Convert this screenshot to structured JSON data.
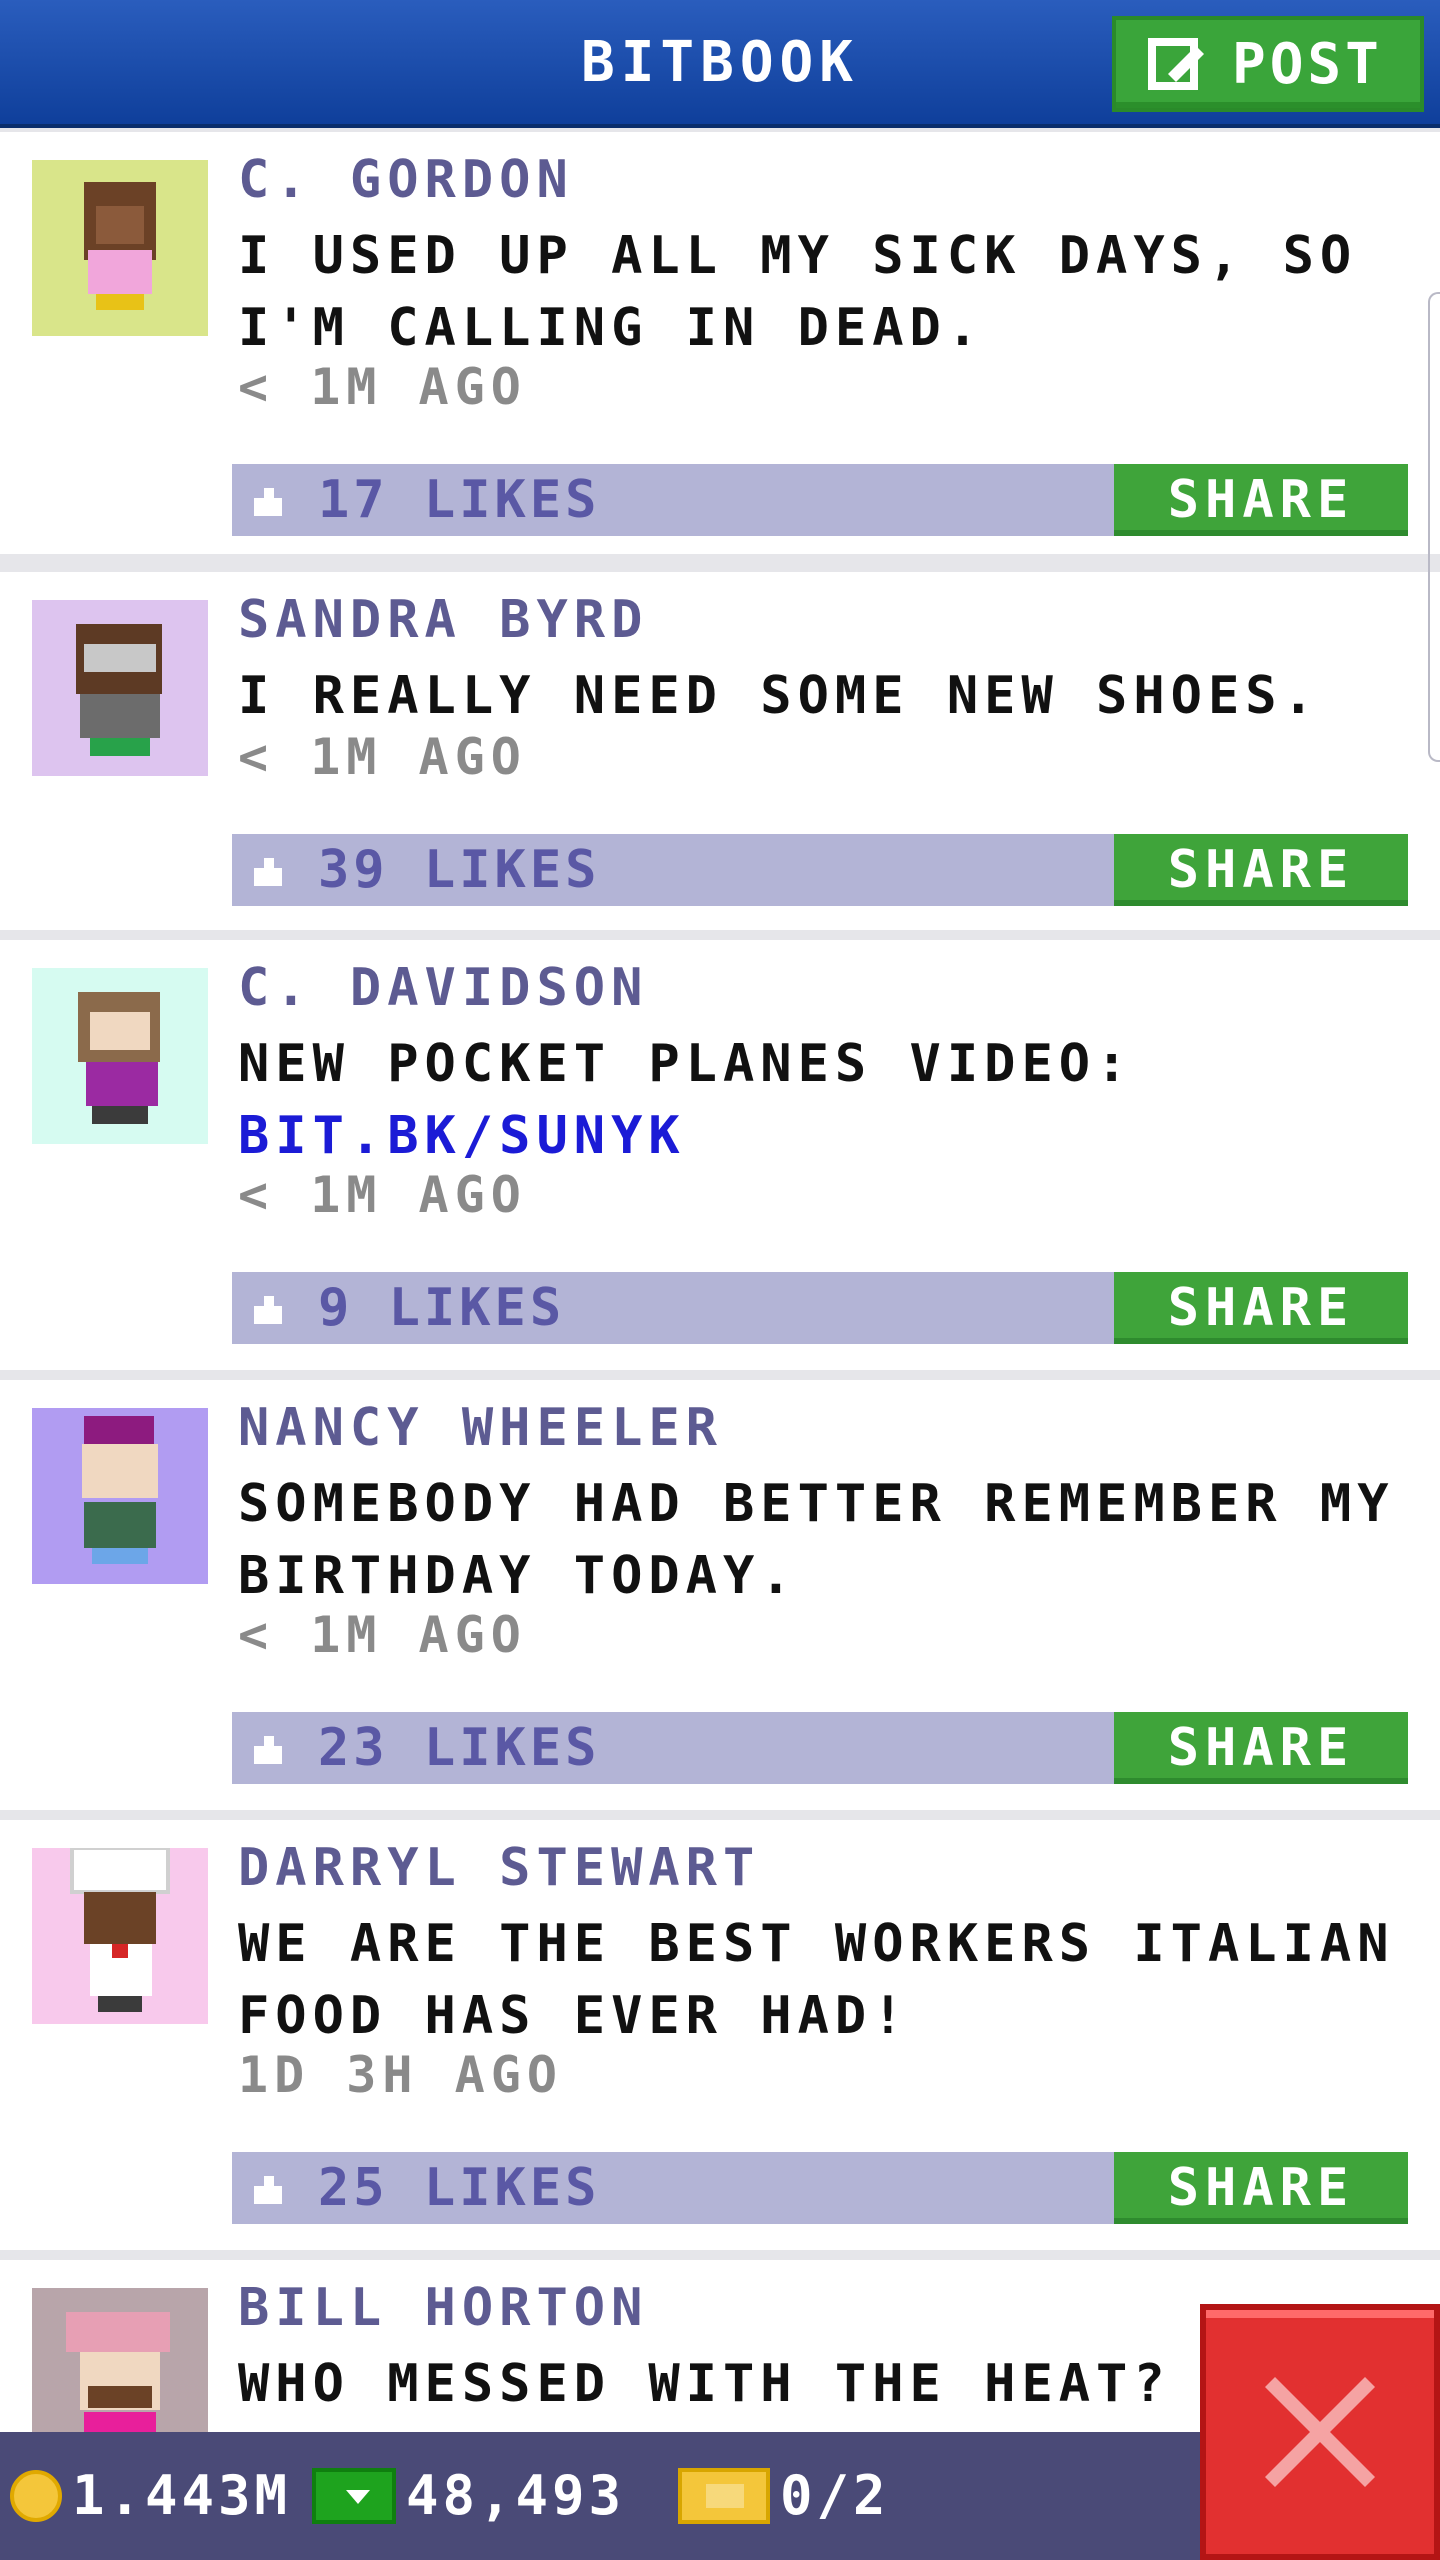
{
  "header": {
    "title": "BITBOOK",
    "post_label": "POST"
  },
  "posts": [
    {
      "author": "C. GORDON",
      "text": "I USED UP ALL MY SICK DAYS, SO I'M CALLING IN DEAD.",
      "time": "< 1M AGO",
      "likes": "17 LIKES",
      "share_label": "SHARE",
      "avatar_bg": "#d9e58a"
    },
    {
      "author": "SANDRA BYRD",
      "text": "I REALLY NEED SOME NEW SHOES.",
      "time": "< 1M AGO",
      "likes": "39 LIKES",
      "share_label": "SHARE",
      "avatar_bg": "#ddc4ef"
    },
    {
      "author": "C. DAVIDSON",
      "text": "NEW POCKET PLANES VIDEO:",
      "link": "BIT.BK/SUNYK",
      "time": "< 1M AGO",
      "likes": "9 LIKES",
      "share_label": "SHARE",
      "avatar_bg": "#d6fbf1"
    },
    {
      "author": "NANCY WHEELER",
      "text": "SOMEBODY HAD BETTER REMEMBER MY BIRTHDAY TODAY.",
      "time": "< 1M AGO",
      "likes": "23 LIKES",
      "share_label": "SHARE",
      "avatar_bg": "#b19cf2"
    },
    {
      "author": "DARRYL STEWART",
      "text": "WE ARE THE BEST WORKERS ITALIAN FOOD HAS EVER HAD!",
      "time": "1D 3H AGO",
      "likes": "25 LIKES",
      "share_label": "SHARE",
      "avatar_bg": "#f8c9ec"
    },
    {
      "author": "BILL HORTON",
      "text": "WHO MESSED WITH THE HEAT? IT'",
      "avatar_bg": "#b8a5aa"
    }
  ],
  "footer": {
    "coins": "1.443M",
    "bux": "48,493",
    "tickets": "0/2"
  }
}
